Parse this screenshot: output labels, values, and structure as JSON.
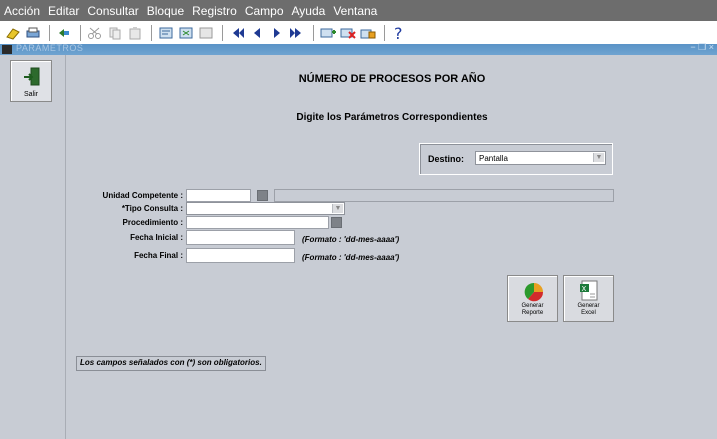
{
  "menu": [
    "Acción",
    "Editar",
    "Consultar",
    "Bloque",
    "Registro",
    "Campo",
    "Ayuda",
    "Ventana"
  ],
  "toolbar_icons": [
    "save-icon",
    "print-icon",
    "navigate-icon",
    "cut-icon",
    "copy-icon",
    "paste-icon",
    "query-enter-icon",
    "query-execute-icon",
    "query-cancel-icon",
    "first-record-icon",
    "previous-record-icon",
    "next-record-icon",
    "last-record-icon",
    "insert-record-icon",
    "delete-record-icon",
    "lock-record-icon",
    "help-icon"
  ],
  "window": {
    "title": "PARAMETROS",
    "controls": "− ❐ ×"
  },
  "sidebar": {
    "exit_label": "Salir"
  },
  "header": {
    "title": "NÚMERO DE PROCESOS POR AÑO",
    "subtitle": "Digite los Parámetros Correspondientes"
  },
  "destino": {
    "label": "Destino:",
    "value": "Pantalla"
  },
  "form": {
    "unidad_label": "Unidad Competente :",
    "tipo_label": "*Tipo Consulta :",
    "procedimiento_label": "Procedimiento :",
    "fecha_inicial_label": "Fecha Inicial :",
    "fecha_final_label": "Fecha Final :",
    "formato_hint": "(Formato : 'dd-mes-aaaa')"
  },
  "buttons": {
    "report": "Generar\nReporte",
    "excel": "Generar\nExcel"
  },
  "footnote": "Los campos señalados con (*) son obligatorios.",
  "colors": {
    "menubar": "#6d6d6d",
    "canvas": "#c8ccd4",
    "titlebar": "#5a93c7"
  }
}
